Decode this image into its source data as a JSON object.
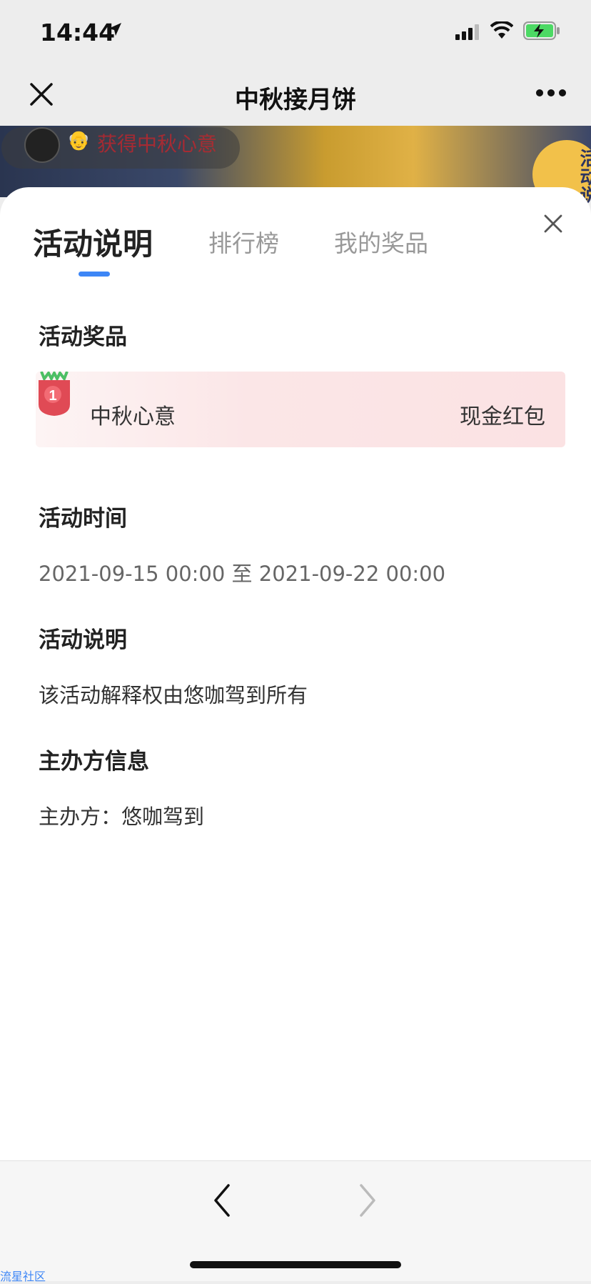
{
  "status_bar": {
    "time": "14:44"
  },
  "nav": {
    "title": "中秋接月饼"
  },
  "banner": {
    "text": "获得中秋心意",
    "emoji": "👴",
    "badge": "活动说"
  },
  "tabs": [
    {
      "label": "活动说明",
      "active": true
    },
    {
      "label": "排行榜",
      "active": false
    },
    {
      "label": "我的奖品",
      "active": false
    }
  ],
  "sections": {
    "prizes_heading": "活动奖品",
    "prize": {
      "rank": "1",
      "name": "中秋心意",
      "type": "现金红包"
    },
    "time_heading": "活动时间",
    "time_value": "2021-09-15 00:00 至 2021-09-22 00:00",
    "desc_heading": "活动说明",
    "desc_value": "该活动解释权由悠咖驾到所有",
    "organizer_heading": "主办方信息",
    "organizer_value": "主办方：悠咖驾到"
  },
  "watermark": "流星社区",
  "colors": {
    "accent": "#3d86f6",
    "prize_bg": "#fbe6e7",
    "medal": "#e04a55"
  }
}
